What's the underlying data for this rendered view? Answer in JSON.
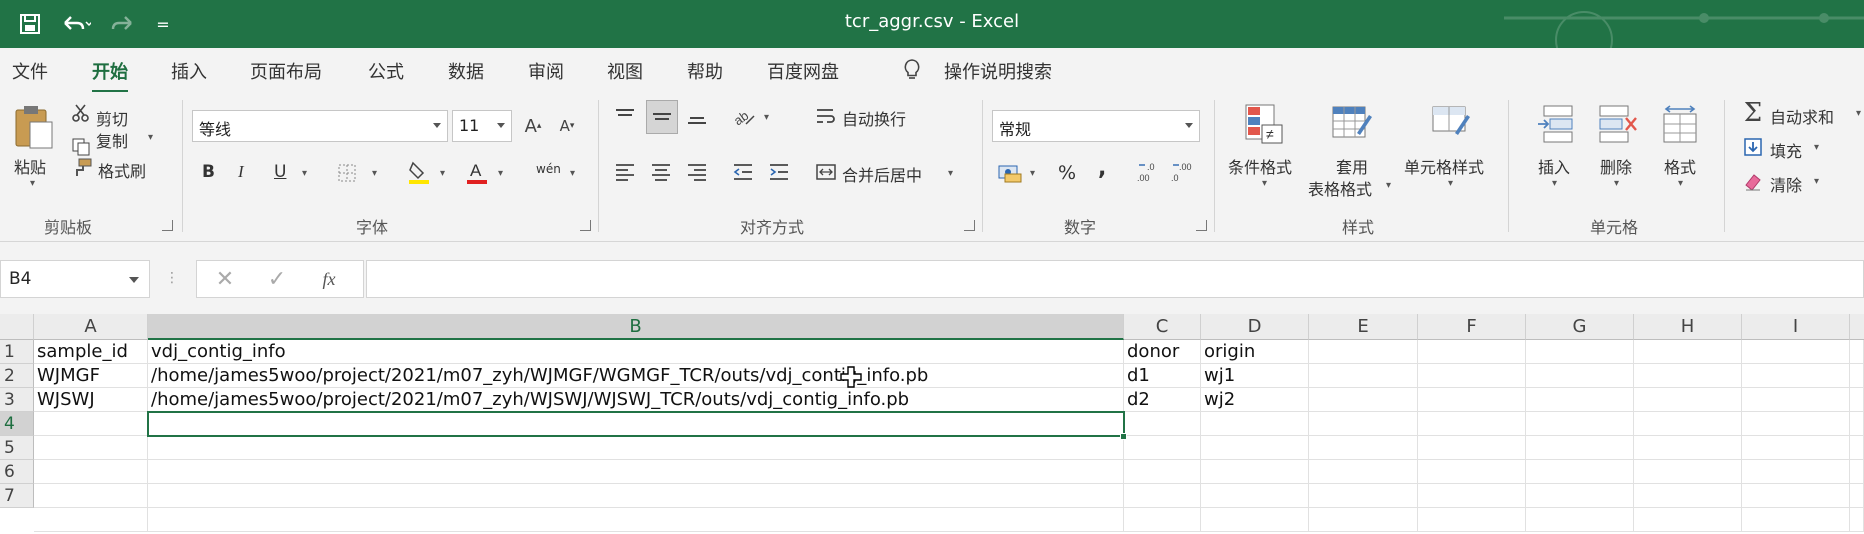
{
  "window": {
    "title": "tcr_aggr.csv  -  Excel",
    "quick_access_more": "="
  },
  "tabs": [
    {
      "label": "文件"
    },
    {
      "label": "开始"
    },
    {
      "label": "插入"
    },
    {
      "label": "页面布局"
    },
    {
      "label": "公式"
    },
    {
      "label": "数据"
    },
    {
      "label": "审阅"
    },
    {
      "label": "视图"
    },
    {
      "label": "帮助"
    },
    {
      "label": "百度网盘"
    },
    {
      "label": "操作说明搜索"
    }
  ],
  "ribbon": {
    "clipboard": {
      "paste": "粘贴",
      "cut": "剪切",
      "copy": "复制",
      "format_painter": "格式刷",
      "group": "剪贴板"
    },
    "font": {
      "font_name": "等线",
      "font_size": "11",
      "bold": "B",
      "italic": "I",
      "underline": "U",
      "phonetic": "wén",
      "group": "字体"
    },
    "alignment": {
      "wrap": "自动换行",
      "merge": "合并后居中",
      "group": "对齐方式"
    },
    "number": {
      "format": "常规",
      "percent": "%",
      "comma": ",",
      "group": "数字"
    },
    "styles": {
      "conditional": "条件格式",
      "table_line1": "套用",
      "table_line2": "表格格式",
      "cell_styles": "单元格样式",
      "group": "样式"
    },
    "cells": {
      "insert": "插入",
      "delete": "删除",
      "format": "格式",
      "group": "单元格"
    },
    "editing": {
      "autosum": "自动求和",
      "fill": "填充",
      "clear": "清除"
    }
  },
  "formula_bar": {
    "name_box": "B4",
    "fx": "fx",
    "value": ""
  },
  "sheet": {
    "columns": [
      "A",
      "B",
      "C",
      "D",
      "E",
      "F",
      "G",
      "H",
      "I"
    ],
    "rows": [
      "1",
      "2",
      "3",
      "4",
      "5",
      "6",
      "7"
    ],
    "active_cell": "B4",
    "cells": {
      "r1": [
        "sample_id",
        "vdj_contig_info",
        "donor",
        "origin"
      ],
      "r2": [
        "WJMGF",
        "/home/james5woo/project/2021/m07_zyh/WJMGF/WGMGF_TCR/outs/vdj_contig_info.pb",
        "d1",
        "wj1"
      ],
      "r3": [
        "WJSWJ",
        "/home/james5woo/project/2021/m07_zyh/WJSWJ/WJSWJ_TCR/outs/vdj_contig_info.pb",
        "d2",
        "wj2"
      ]
    }
  },
  "colors": {
    "accent": "#217346",
    "ribbon_bg": "#f3f3f3",
    "header_bg": "#ececec"
  }
}
